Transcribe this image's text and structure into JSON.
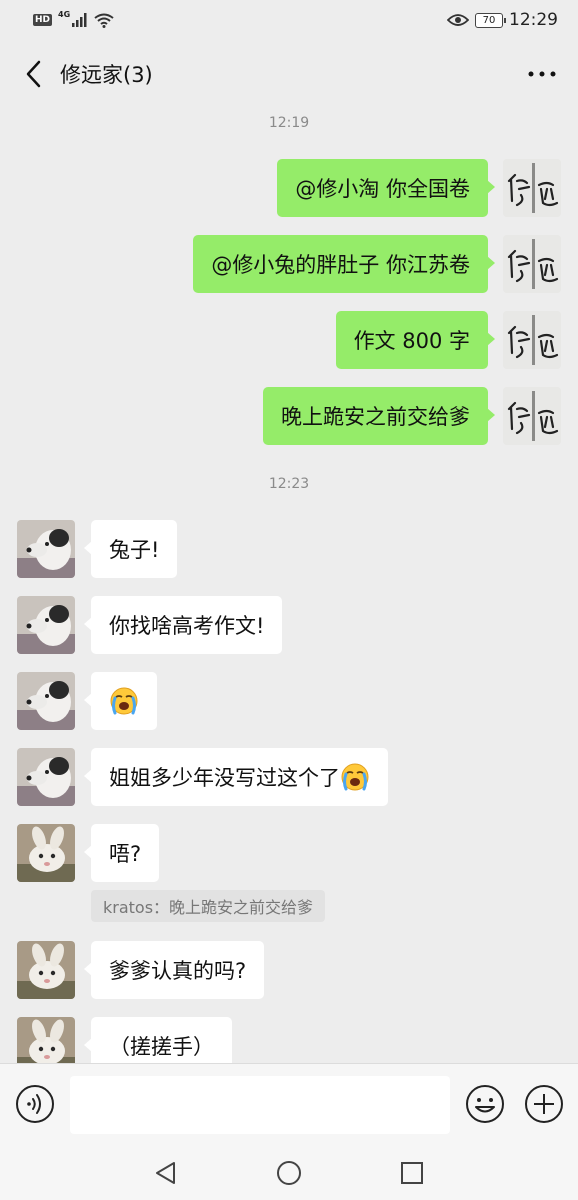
{
  "status_bar": {
    "hd": "HD",
    "network": "4G",
    "battery": "70",
    "time": "12:29"
  },
  "header": {
    "title": "修远家(3)"
  },
  "chat": {
    "timestamp_1": "12:19",
    "sent_1": "@修小淘  你全国卷",
    "sent_2": "@修小兔的胖肚子  你江苏卷",
    "sent_3": "作文 800 字",
    "sent_4": "晚上跪安之前交给爹",
    "timestamp_2": "12:23",
    "recv_1": "兔子!",
    "recv_2": "你找啥高考作文!",
    "recv_4": "姐姐多少年没写过这个了",
    "recv_5": "唔?",
    "quote": "kratos：晚上跪安之前交给爹",
    "recv_6": "爹爹认真的吗?",
    "recv_7": "（搓搓手）"
  },
  "icons": {
    "back": "chevron-left-icon",
    "more": "more-icon",
    "voice": "voice-icon",
    "emoji": "emoji-icon",
    "plus": "plus-icon",
    "crying_emoji": "loudly-crying-face-emoji"
  },
  "colors": {
    "background": "#ededed",
    "sent_bubble": "#95ec69",
    "received_bubble": "#ffffff",
    "timestamp": "#8a8a8a"
  }
}
